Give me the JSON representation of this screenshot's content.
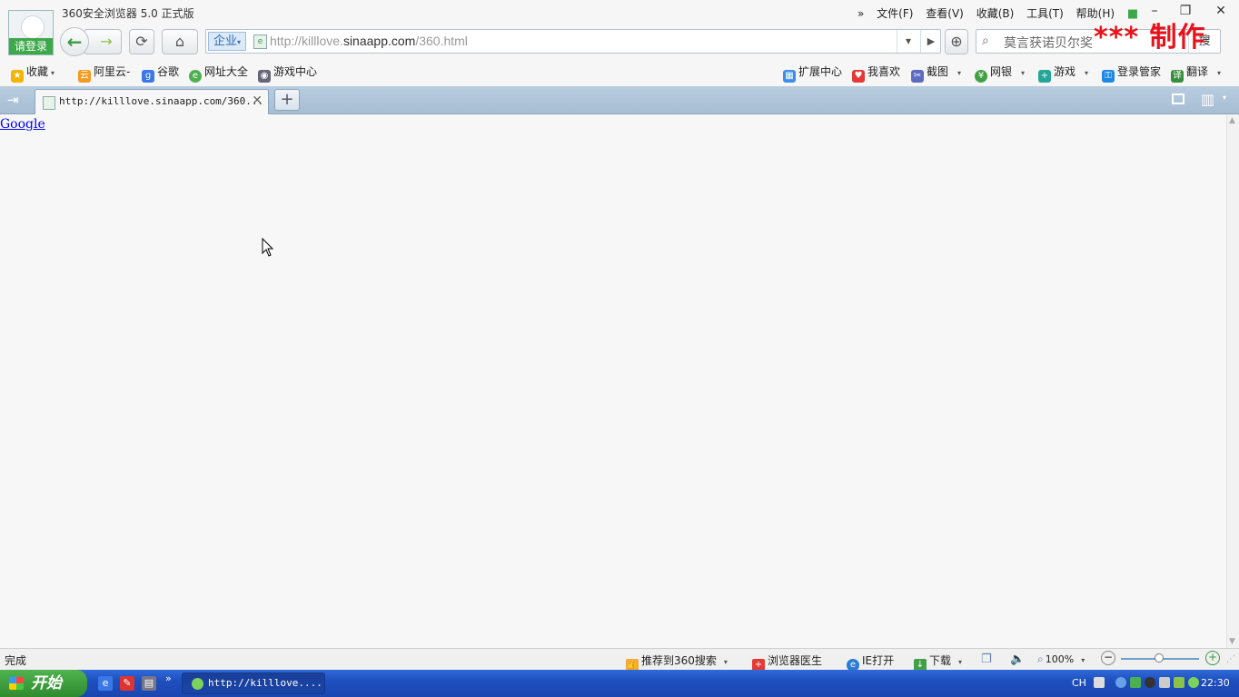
{
  "window": {
    "app_title": "360安全浏览器 5.0 正式版",
    "login_label": "请登录",
    "menu": [
      "文件(F)",
      "查看(V)",
      "收藏(B)",
      "工具(T)",
      "帮助(H)"
    ],
    "menu_more": "»",
    "minimize": "–",
    "restore": "❐",
    "close": "✕"
  },
  "toolbar": {
    "back": "←",
    "forward": "→",
    "reload": "⟳",
    "home": "⌂",
    "enterprise_label": "企业",
    "enterprise_caret": "▾",
    "url_prefix": "http://killlove.",
    "url_domain": "sinaapp.com",
    "url_suffix": "/360.html",
    "url_dropdown": "▾",
    "url_go": "▶",
    "shield": "⊕",
    "search_placeholder": "莫言获诺贝尔奖",
    "search_button": "搜"
  },
  "watermark": "*** 制作",
  "bookmarks": [
    {
      "label": "收藏",
      "icon": "star-icon",
      "color": "#f5b400",
      "caret": "▾"
    },
    {
      "label": "阿里云-",
      "icon": "aliyun-icon",
      "color": "#f39a1e"
    },
    {
      "label": "谷歌",
      "icon": "google-icon",
      "color": "#3b78e7"
    },
    {
      "label": "网址大全",
      "icon": "site-nav-icon",
      "color": "#4caf50"
    },
    {
      "label": "游戏中心",
      "icon": "gamepad-icon",
      "color": "#667"
    },
    {
      "label": "扩展中心",
      "icon": "extension-icon",
      "color": "#3a8ee6"
    },
    {
      "label": "我喜欢",
      "icon": "heart-icon",
      "color": "#e53935"
    },
    {
      "label": "截图",
      "icon": "screenshot-icon",
      "color": "#5c6bc0",
      "caret": "▾"
    },
    {
      "label": "网银",
      "icon": "bank-icon",
      "color": "#43a047",
      "caret": "▾"
    },
    {
      "label": "游戏",
      "icon": "game-icon",
      "color": "#26a69a",
      "caret": "▾"
    },
    {
      "label": "登录管家",
      "icon": "key-icon",
      "color": "#1e88e5"
    },
    {
      "label": "翻译",
      "icon": "translate-icon",
      "color": "#388e3c",
      "caret": "▾"
    }
  ],
  "tabs": {
    "sidebar_toggle": "⇥",
    "active_title": "http://killlove.sinaapp.com/360...",
    "close": "✕",
    "new_tab": "+",
    "trash": "🗑",
    "more": "▾"
  },
  "content": {
    "link_text": "Google"
  },
  "statusbar": {
    "status": "完成",
    "recommend": "推荐到360搜索",
    "doctor": "浏览器医生",
    "ie_open": "IE打开",
    "download": "下载",
    "zoom": "100%",
    "caret": "▾",
    "zoom_out": "−",
    "zoom_in": "+"
  },
  "taskbar": {
    "start": "开始",
    "ql_more": "»",
    "task_title": "http://killlove....",
    "lang": "CH",
    "clock": "22:30"
  }
}
